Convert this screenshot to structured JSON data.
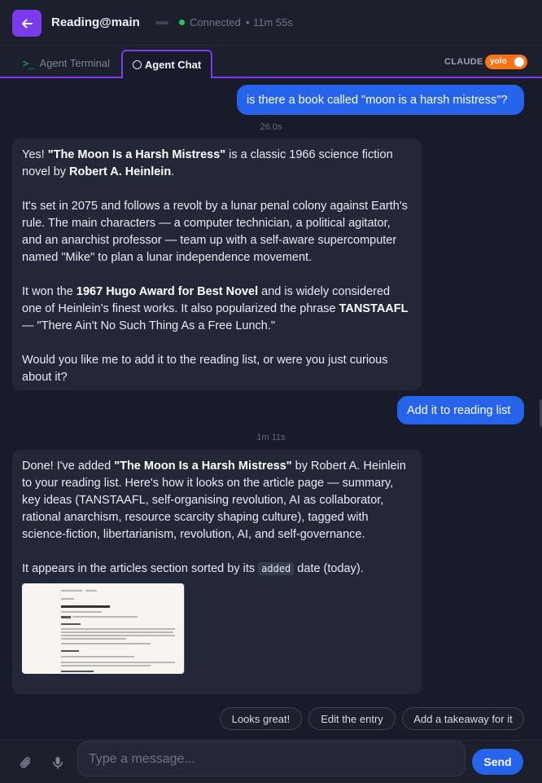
{
  "header": {
    "title": "Reading@main",
    "status": "Connected",
    "separator": "•",
    "elapsed": "11m 55s"
  },
  "tabs": [
    {
      "prompt": ">_",
      "label": "Agent Terminal"
    },
    {
      "label": "Agent Chat"
    }
  ],
  "mode": {
    "label": "CLAUDE",
    "toggle_label": "yolo"
  },
  "messages": {
    "user1": "is there a book called \"moon is a harsh mistress\"?",
    "ts1": "26.0s",
    "agent1": {
      "p1_pre": "Yes! ",
      "p1_bold1": "\"The Moon Is a Harsh Mistress\"",
      "p1_mid": " is a classic 1966 science fiction novel by ",
      "p1_bold2": "Robert A. Heinlein",
      "p1_end": ".",
      "p2": "It's set in 2075 and follows a revolt by a lunar penal colony against Earth's rule. The main characters — a computer technician, a political agitator, and an anarchist professor — team up with a self-aware supercomputer named \"Mike\" to plan a lunar independence movement.",
      "p3_pre": "It won the ",
      "p3_bold1": "1967 Hugo Award for Best Novel",
      "p3_mid": " and is widely considered one of Heinlein's finest works. It also popularized the phrase ",
      "p3_bold2": "TANSTAAFL",
      "p3_end": " — \"There Ain't No Such Thing As a Free Lunch.\"",
      "p4": "Would you like me to add it to the reading list, or were you just curious about it?"
    },
    "user2": "Add it to reading list",
    "ts2": "1m 11s",
    "agent2": {
      "p1_pre": "Done! I've added ",
      "p1_bold": "\"The Moon Is a Harsh Mistress\"",
      "p1_end": " by Robert A. Heinlein to your reading list. Here's how it looks on the article page — summary, key ideas (TANSTAAFL, self-organising revolution, AI as collaborator, rational anarchism, resource scarcity shaping culture), tagged with science-fiction, libertarianism, revolution, AI, and self-governance.",
      "p2_pre": "It appears in the articles section sorted by its ",
      "p2_code": "added",
      "p2_end": " date (today)."
    }
  },
  "quick_replies": [
    "Looks great!",
    "Edit the entry",
    "Add a takeaway for it"
  ],
  "composer": {
    "placeholder": "Type a message...",
    "send_label": "Send"
  },
  "colors": {
    "accent": "#7c3aed",
    "user_bubble": "#2563eb",
    "status_ok": "#22c55e",
    "yolo": "#f97316"
  }
}
